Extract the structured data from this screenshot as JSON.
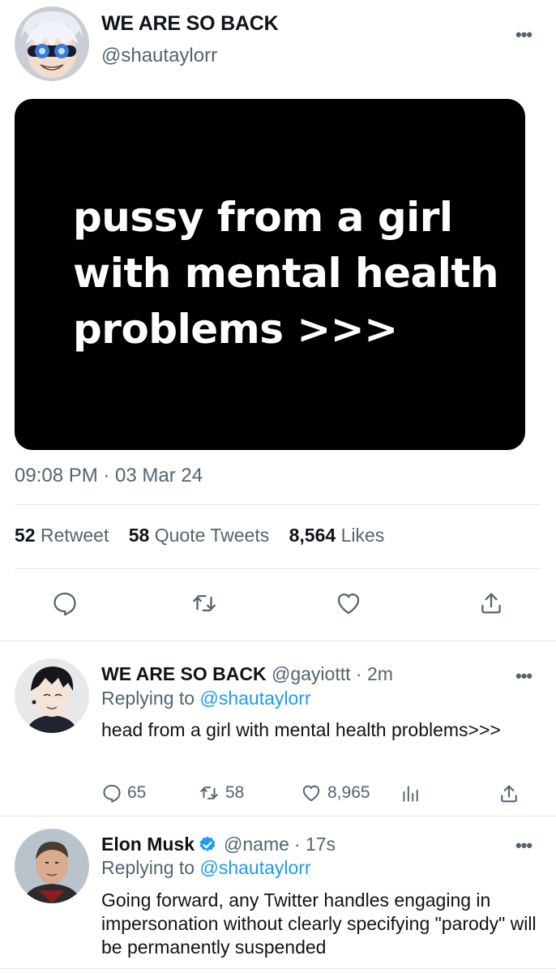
{
  "main_tweet": {
    "display_name": "WE ARE SO BACK",
    "handle": "@shautaylorr",
    "more": "•••",
    "image_text": "pussy from a girl with mental health problems >>>",
    "timestamp": "09:08 PM · 03 Mar 24",
    "stats": {
      "retweets_count": "52",
      "retweets_label": "Retweet",
      "quotes_count": "58",
      "quotes_label": "Quote Tweets",
      "likes_count": "8,564",
      "likes_label": "Likes"
    },
    "actions": [
      "reply-icon",
      "retweet-icon",
      "like-icon",
      "share-icon"
    ]
  },
  "replies": [
    {
      "display_name": "WE ARE SO BACK",
      "handle": "@gayiottt",
      "time": "· 2m",
      "replying_prefix": "Replying to",
      "replying_to": "@shautaylorr",
      "body": "head from a girl with mental health problems>>>",
      "more": "•••",
      "counts": {
        "replies": "65",
        "retweets": "58",
        "likes": "8,965"
      }
    },
    {
      "display_name": "Elon Musk",
      "verified": true,
      "handle": "@name",
      "time": "· 17s",
      "replying_prefix": "Replying to",
      "replying_to": "@shautaylorr",
      "body": "Going forward, any Twitter handles engaging in impersonation without clearly specifying \"parody\" will be permanently suspended",
      "more": "•••"
    }
  ],
  "colors": {
    "link": "#1d9bf0",
    "secondary": "#536471",
    "verified": "#1d9bf0"
  }
}
